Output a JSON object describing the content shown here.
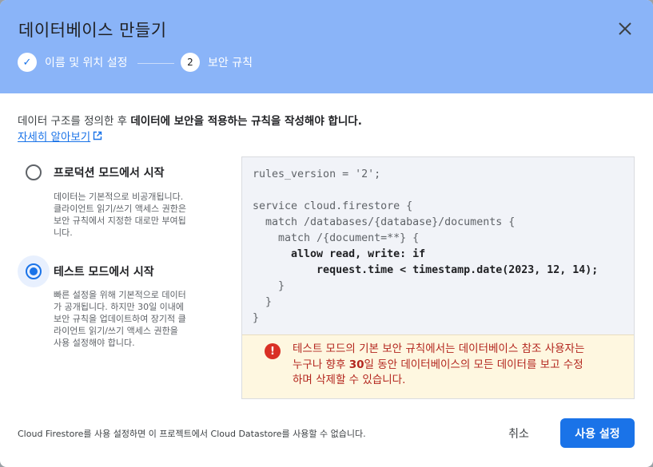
{
  "dialog": {
    "title": "데이터베이스 만들기",
    "close_icon": "close-icon"
  },
  "steps": [
    {
      "marker": "✓",
      "label": "이름 및 위치 설정",
      "state": "done"
    },
    {
      "marker": "2",
      "label": "보안 규칙",
      "state": "current"
    }
  ],
  "intro": {
    "text_part1": "데이터 구조를 정의한 후 ",
    "text_bold": "데이터에 보안을 적용하는 규칙을 작성해야 합니다.",
    "learn_more": "자세히 알아보기",
    "learn_more_icon": "open-in-new-icon"
  },
  "options": [
    {
      "title": "프로덕션 모드에서 시작",
      "selected": false,
      "desc_lines": [
        "데이터는 기본적으로 비공개됩니다.",
        "클라이언트 읽기/쓰기 액세스 권한은",
        "보안 규칙에서 지정한 대로만 부여됩",
        "니다."
      ]
    },
    {
      "title": "테스트 모드에서 시작",
      "selected": true,
      "desc_lines": [
        "빠른 설정을 위해 기본적으로 데이터",
        "가 공개됩니다. 하지만 30일 이내에",
        "보안 규칙을 업데이트하여 장기적 클",
        "라이언트 읽기/쓰기 액세스 권한을",
        "사용 설정해야 합니다."
      ]
    }
  ],
  "rules": {
    "lines": [
      "rules_version = '2';",
      "",
      "service cloud.firestore {",
      "  match /databases/{database}/documents {",
      "    match /{document=**} {",
      "      allow read, write: if",
      "          request.time < timestamp.date(2023, 12, 14);",
      "    }",
      "  }",
      "}"
    ]
  },
  "warning": {
    "icon": "error-icon",
    "line1": "테스트 모드의 기본 보안 규칙에서는 데이터베이스 참조 사용자는",
    "line2_pre": "누구나 향후 ",
    "line2_bold": "30",
    "line2_post": "일 동안 데이터베이스의 모든 데이터를 보고 수정",
    "line3": "하며 삭제할 수 있습니다."
  },
  "footer": {
    "note": "Cloud Firestore를 사용 설정하면 이 프로젝트에서 Cloud Datastore를 사용할 수 없습니다.",
    "cancel_label": "취소",
    "enable_label": "사용 설정"
  },
  "colors": {
    "header_bg": "#8ab4f8",
    "accent": "#1a73e8",
    "warning_bg": "#fef7e0",
    "warning_text": "#b3261e",
    "code_bg": "#f1f3f8"
  }
}
